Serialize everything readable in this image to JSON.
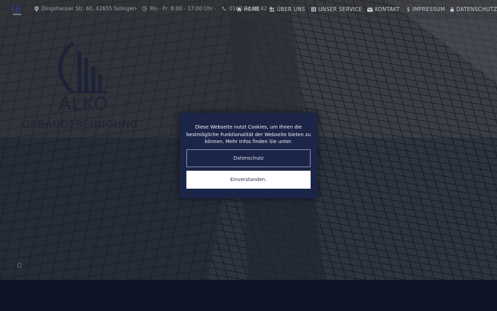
{
  "topbar": {
    "logo_alt": "ALKO Gebäudereinigung",
    "address": "Dingshauser Str. 60,  42655 Solingen",
    "hours": "Mo - Fr: 8:00 - 17:00 Uhr",
    "phone": "0160 74 28 42 4",
    "separator": "-"
  },
  "nav": {
    "items": [
      {
        "label": "HOME",
        "icon": "home-icon"
      },
      {
        "label": "ÜBER UNS",
        "icon": "users-icon"
      },
      {
        "label": "UNSER SERVICE",
        "icon": "grid-icon"
      },
      {
        "label": "KONTAKT",
        "icon": "envelope-icon"
      },
      {
        "label": "IMPRESSUM",
        "icon": "dollar-icon"
      },
      {
        "label": "DATENSCHUTZ",
        "icon": "lock-icon"
      }
    ]
  },
  "hero": {
    "logo_title": "ALKO",
    "logo_subtitle": "GEBÄUDEREINIGUNG"
  },
  "cookie": {
    "message": "Diese Webseite nutzt Cookies, um Ihnen die bestmögliche Funktionalität der Webseite bieten zu können. Mehr Infos finden Sie unter.",
    "privacy_button": "Datenschutz",
    "accept_button": "Einverstanden."
  },
  "colors": {
    "modal_bg": "#1b2547",
    "button_solid": "#ffffff",
    "footer": "#0c1425"
  }
}
